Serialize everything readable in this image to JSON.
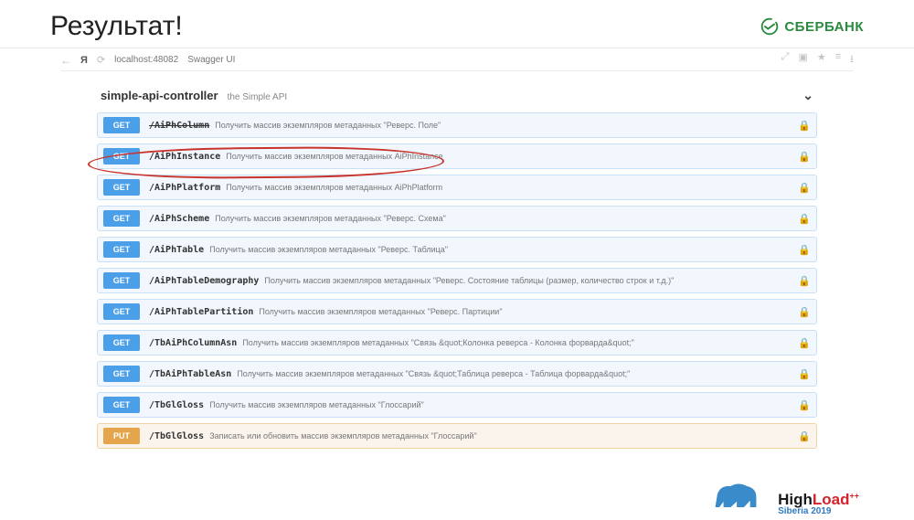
{
  "slide": {
    "title": "Результат!"
  },
  "brand": {
    "sber": "СБЕРБАНК"
  },
  "browser": {
    "url": "localhost:48082",
    "pagetitle": "Swagger UI",
    "yandex": "Я"
  },
  "controller": {
    "name": "simple-api-controller",
    "desc": "the Simple API"
  },
  "ops": [
    {
      "method": "GET",
      "path": "/AiPhColumn",
      "desc": "Получить массив экземпляров метаданных \"Реверс. Поле\""
    },
    {
      "method": "GET",
      "path": "/AiPhInstance",
      "desc": "Получить массив экземпляров метаданных AiPhInstance"
    },
    {
      "method": "GET",
      "path": "/AiPhPlatform",
      "desc": "Получить массив экземпляров метаданных AiPhPlatform"
    },
    {
      "method": "GET",
      "path": "/AiPhScheme",
      "desc": "Получить массив экземпляров метаданных \"Реверс. Схема\""
    },
    {
      "method": "GET",
      "path": "/AiPhTable",
      "desc": "Получить массив экземпляров метаданных \"Реверс. Таблица\""
    },
    {
      "method": "GET",
      "path": "/AiPhTableDemography",
      "desc": "Получить массив экземпляров метаданных \"Реверс. Состояние таблицы (размер, количество строк и т.д.)\""
    },
    {
      "method": "GET",
      "path": "/AiPhTablePartition",
      "desc": "Получить массив экземпляров метаданных \"Реверс. Партиции\""
    },
    {
      "method": "GET",
      "path": "/TbAiPhColumnAsn",
      "desc": "Получить массив экземпляров метаданных \"Связь &quot;Колонка реверса - Колонка форварда&quot;\""
    },
    {
      "method": "GET",
      "path": "/TbAiPhTableAsn",
      "desc": "Получить массив экземпляров метаданных \"Связь &quot;Таблица реверса - Таблица форварда&quot;\""
    },
    {
      "method": "GET",
      "path": "/TbGlGloss",
      "desc": "Получить массив экземпляров метаданных \"Глоссарий\""
    },
    {
      "method": "PUT",
      "path": "/TbGlGloss",
      "desc": "Записать или обновить массив экземпляров метаданных \"Глоссарий\""
    }
  ],
  "footer": {
    "highload": "HighLoad",
    "plus": "++",
    "sub": "Siberia 2019"
  }
}
